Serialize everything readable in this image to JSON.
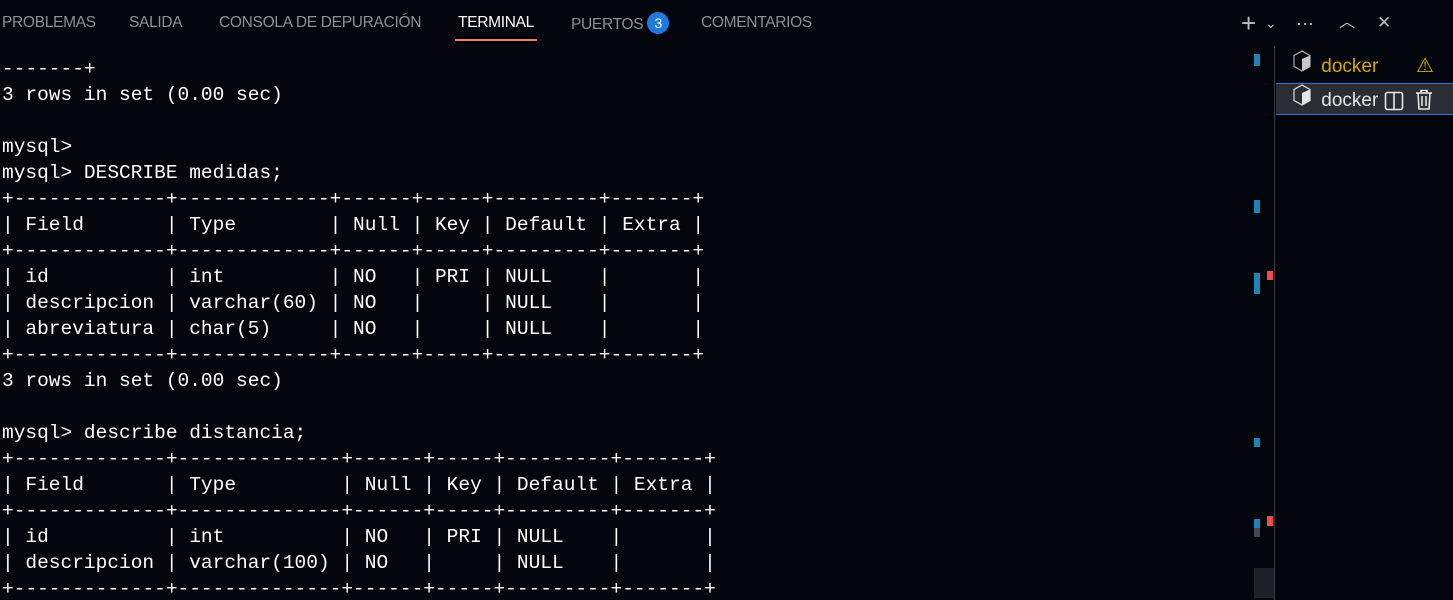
{
  "tabs": [
    {
      "label": "PROBLEMAS"
    },
    {
      "label": "SALIDA"
    },
    {
      "label": "CONSOLA DE DEPURACIÓN"
    },
    {
      "label": "TERMINAL",
      "active": true
    },
    {
      "label": "PUERTOS",
      "badge": "3"
    },
    {
      "label": "COMENTARIOS"
    }
  ],
  "actions": {
    "new_terminal": "+",
    "dropdown": "⌄",
    "more": "···",
    "maximize": "︿",
    "close": "✕"
  },
  "terminal_lines": [
    "-------+",
    "3 rows in set (0.00 sec)",
    "",
    "mysql>",
    "mysql> DESCRIBE medidas;",
    "+-------------+-------------+------+-----+---------+-------+",
    "| Field       | Type        | Null | Key | Default | Extra |",
    "+-------------+-------------+------+-----+---------+-------+",
    "| id          | int         | NO   | PRI | NULL    |       |",
    "| descripcion | varchar(60) | NO   |     | NULL    |       |",
    "| abreviatura | char(5)     | NO   |     | NULL    |       |",
    "+-------------+-------------+------+-----+---------+-------+",
    "3 rows in set (0.00 sec)",
    "",
    "mysql> describe distancia;",
    "+-------------+--------------+------+-----+---------+-------+",
    "| Field       | Type         | Null | Key | Default | Extra |",
    "+-------------+--------------+------+-----+---------+-------+",
    "| id          | int          | NO   | PRI | NULL    |       |",
    "| descripcion | varchar(100) | NO   |     | NULL    |       |",
    "+-------------+--------------+------+-----+---------+-------+"
  ],
  "instances": [
    {
      "label": "docker",
      "status": "warning",
      "color": "#d4a60a"
    },
    {
      "label": "docker",
      "selected": true,
      "color": "#e6e6e6"
    }
  ],
  "colors": {
    "accent": "#1f7ae0",
    "tab_underline": "#f27d6a",
    "marker_blue": "#1b85b8",
    "marker_red": "#f14c4c"
  }
}
